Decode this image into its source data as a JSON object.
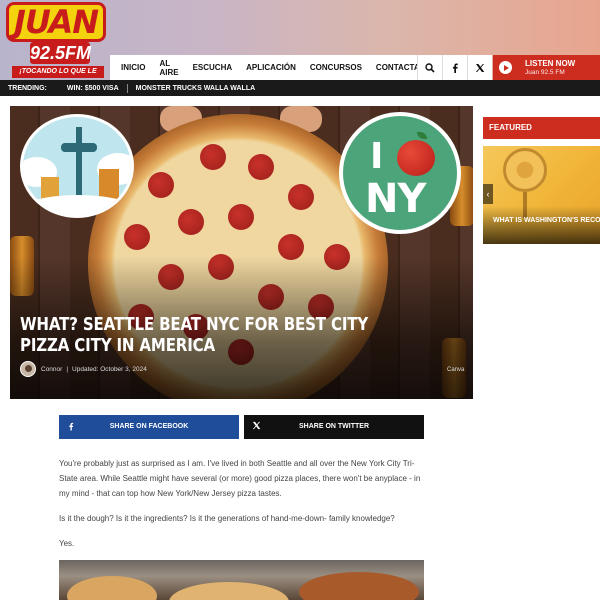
{
  "brand": {
    "name": "JUAN",
    "frequency": "92.5FM",
    "tagline": "¡TOCANDO LO QUE LE GUSTA!",
    "accent": "#cc2d1f",
    "logo_yellow": "#f4d20d"
  },
  "nav": {
    "items": [
      {
        "label": "INICIO"
      },
      {
        "label": "AL AIRE"
      },
      {
        "label": "ESCUCHA"
      },
      {
        "label": "APLICACIÓN"
      },
      {
        "label": "CONCURSOS"
      },
      {
        "label": "CONTACTANOS"
      }
    ],
    "icons": [
      "search-icon",
      "facebook-icon",
      "x-twitter-icon"
    ]
  },
  "listen": {
    "title": "LISTEN NOW",
    "station": "Juan 92.5 FM"
  },
  "trending": {
    "label": "TRENDING:",
    "items": [
      {
        "label": "WIN: $500 VISA"
      },
      {
        "label": "MONSTER TRUCKS WALLA WALLA"
      }
    ]
  },
  "hero": {
    "title": "WHAT? SEATTLE BEAT NYC FOR BEST CITY PIZZA CITY IN AMERICA",
    "author": "Connor",
    "updated": "Updated: October 3, 2024",
    "credit": "Canva",
    "sticker_left": "seattle-space-needle",
    "sticker_right": {
      "i": "I",
      "ny": "NY"
    }
  },
  "share": {
    "facebook": "SHARE ON FACEBOOK",
    "twitter": "SHARE ON TWITTER"
  },
  "article": {
    "paragraphs": [
      "You're probably just as surprised as I am. I've lived in both Seattle and all over the New York City Tri-State area. While Seattle might have several (or more) good pizza places, there won't be anyplace - in my mind - that can top how New York/New Jersey pizza tastes.",
      "Is it the dough? Is it the ingredients? Is it the generations of hand-me-down- family knowledge?",
      "Yes."
    ]
  },
  "sidebar": {
    "featured_label": "FEATURED",
    "card_title": "WHAT IS WASHINGTON'S RECORD HIGH TEMP?"
  }
}
